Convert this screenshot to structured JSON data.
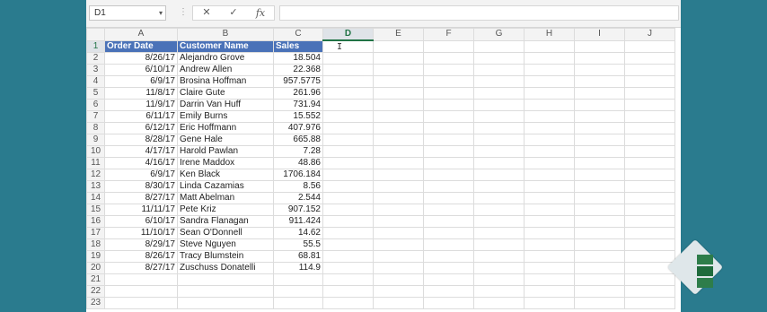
{
  "formula_bar": {
    "name_box": "D1",
    "name_box_arrow": "▾",
    "separator": "⋮",
    "cancel_icon": "✕",
    "enter_icon": "✓",
    "function_icon": "fx",
    "value": ""
  },
  "columns": [
    "A",
    "B",
    "C",
    "D",
    "E",
    "F",
    "G",
    "H",
    "I",
    "J"
  ],
  "active_column": "D",
  "active_row": 1,
  "headers": [
    "Order Date",
    "Customer Name",
    "Sales"
  ],
  "rows": [
    {
      "num": "2",
      "date": "8/26/17",
      "name": "Alejandro Grove",
      "sales": "18.504"
    },
    {
      "num": "3",
      "date": "6/10/17",
      "name": "Andrew Allen",
      "sales": "22.368"
    },
    {
      "num": "4",
      "date": "6/9/17",
      "name": "Brosina Hoffman",
      "sales": "957.5775"
    },
    {
      "num": "5",
      "date": "11/8/17",
      "name": "Claire Gute",
      "sales": "261.96"
    },
    {
      "num": "6",
      "date": "11/9/17",
      "name": "Darrin Van Huff",
      "sales": "731.94"
    },
    {
      "num": "7",
      "date": "6/11/17",
      "name": "Emily Burns",
      "sales": "15.552"
    },
    {
      "num": "8",
      "date": "6/12/17",
      "name": "Eric Hoffmann",
      "sales": "407.976"
    },
    {
      "num": "9",
      "date": "8/28/17",
      "name": "Gene Hale",
      "sales": "665.88"
    },
    {
      "num": "10",
      "date": "4/17/17",
      "name": "Harold Pawlan",
      "sales": "7.28"
    },
    {
      "num": "11",
      "date": "4/16/17",
      "name": "Irene Maddox",
      "sales": "48.86"
    },
    {
      "num": "12",
      "date": "6/9/17",
      "name": "Ken Black",
      "sales": "1706.184"
    },
    {
      "num": "13",
      "date": "8/30/17",
      "name": "Linda Cazamias",
      "sales": "8.56"
    },
    {
      "num": "14",
      "date": "8/27/17",
      "name": "Matt Abelman",
      "sales": "2.544"
    },
    {
      "num": "15",
      "date": "11/11/17",
      "name": "Pete Kriz",
      "sales": "907.152"
    },
    {
      "num": "16",
      "date": "6/10/17",
      "name": "Sandra Flanagan",
      "sales": "911.424"
    },
    {
      "num": "17",
      "date": "11/10/17",
      "name": "Sean O'Donnell",
      "sales": "14.62"
    },
    {
      "num": "18",
      "date": "8/29/17",
      "name": "Steve Nguyen",
      "sales": "55.5"
    },
    {
      "num": "19",
      "date": "8/26/17",
      "name": "Tracy Blumstein",
      "sales": "68.81"
    },
    {
      "num": "20",
      "date": "8/27/17",
      "name": "Zuschuss Donatelli",
      "sales": "114.9"
    }
  ],
  "empty_rows": [
    "21",
    "22",
    "23"
  ],
  "header_row_num": "1",
  "colors": {
    "table_header": "#4a72b8",
    "selection": "#217346",
    "background": "#2a7b8e"
  },
  "logo_icon": "excel-logo-icon"
}
